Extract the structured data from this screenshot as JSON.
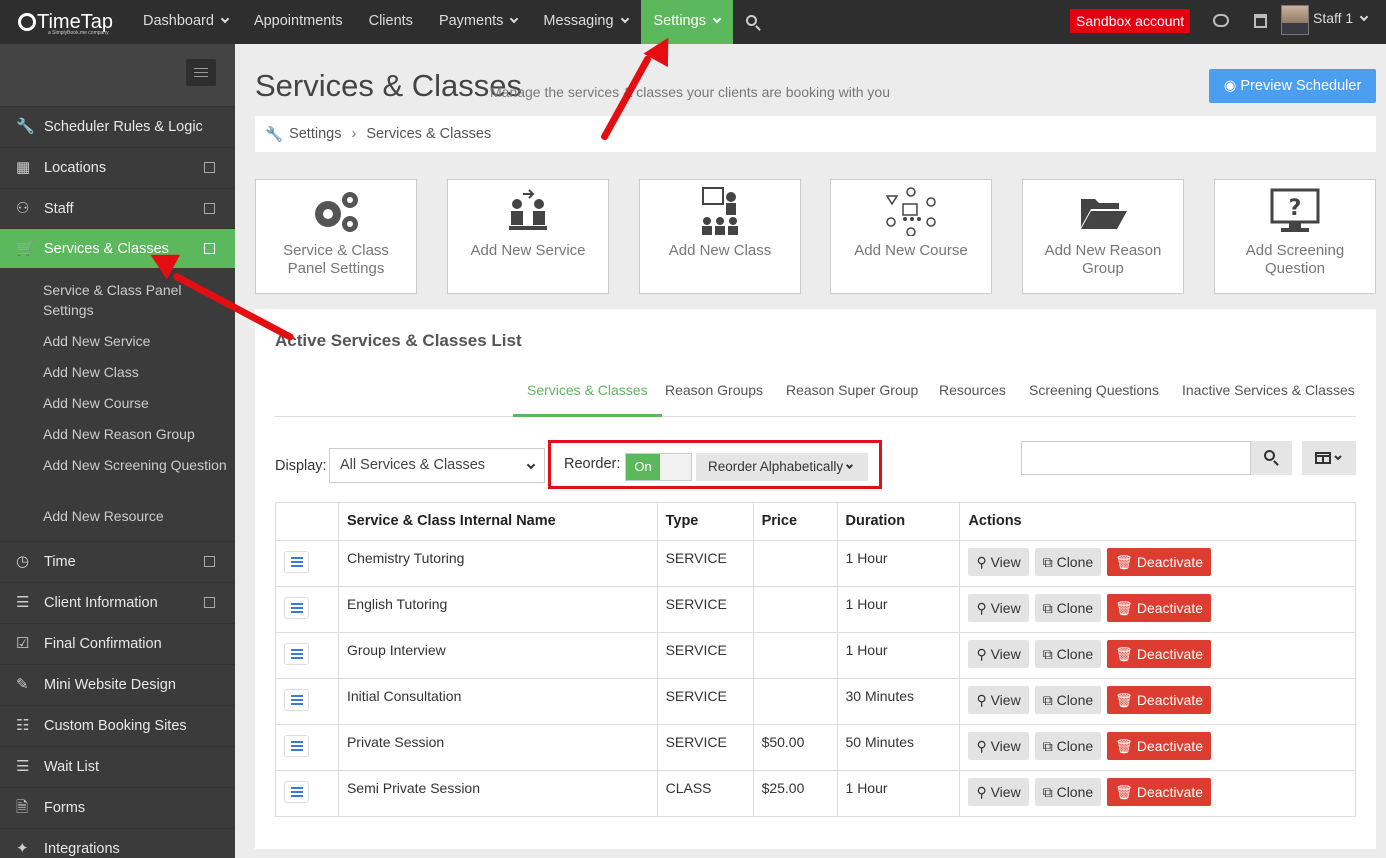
{
  "app": {
    "logo_text": "TimeTap",
    "logo_sub": "a SimplyBook.me company"
  },
  "topnav": {
    "items": [
      {
        "label": "Dashboard",
        "caret": true
      },
      {
        "label": "Appointments",
        "caret": false
      },
      {
        "label": "Clients",
        "caret": false
      },
      {
        "label": "Payments",
        "caret": true
      },
      {
        "label": "Messaging",
        "caret": true
      },
      {
        "label": "Settings",
        "caret": true,
        "active": true
      }
    ],
    "sandbox_label": "Sandbox account",
    "user_label": "Staff 1"
  },
  "sidebar": {
    "items": [
      {
        "label": "Scheduler Rules & Logic",
        "icon": "wrench-icon",
        "box": false
      },
      {
        "label": "Locations",
        "icon": "building-icon",
        "box": true
      },
      {
        "label": "Staff",
        "icon": "users-icon",
        "box": true
      },
      {
        "label": "Services & Classes",
        "icon": "cart-icon",
        "box": true,
        "active": true
      },
      {
        "label": "Time",
        "icon": "clock-icon",
        "box": true
      },
      {
        "label": "Client Information",
        "icon": "list-alt-icon",
        "box": true
      },
      {
        "label": "Final Confirmation",
        "icon": "check-square-icon",
        "box": false
      },
      {
        "label": "Mini Website Design",
        "icon": "edit-icon",
        "box": false
      },
      {
        "label": "Custom Booking Sites",
        "icon": "sitemap-icon",
        "box": false
      },
      {
        "label": "Wait List",
        "icon": "list-icon",
        "box": false
      },
      {
        "label": "Forms",
        "icon": "file-icon",
        "box": false
      },
      {
        "label": "Integrations",
        "icon": "puzzle-icon",
        "box": false
      }
    ],
    "subitems": [
      "Service & Class Panel Settings",
      "Add New Service",
      "Add New Class",
      "Add New Course",
      "Add New Reason Group",
      "Add New Screening Question",
      "Add New Resource"
    ]
  },
  "page": {
    "title": "Services & Classes",
    "subtitle": "Manage the services & classes your clients are booking with you",
    "preview_label": "Preview Scheduler",
    "breadcrumb": [
      "Settings",
      "Services & Classes"
    ]
  },
  "tiles": [
    {
      "label": "Service & Class Panel Settings",
      "icon": "cogs-icon"
    },
    {
      "label": "Add New Service",
      "icon": "service-icon"
    },
    {
      "label": "Add New Class",
      "icon": "class-icon"
    },
    {
      "label": "Add New Course",
      "icon": "course-icon"
    },
    {
      "label": "Add New Reason Group",
      "icon": "folder-open-icon"
    },
    {
      "label": "Add Screening Question",
      "icon": "screen-question-icon"
    }
  ],
  "list": {
    "title": "Active Services & Classes List",
    "tabs": [
      "Services & Classes",
      "Reason Groups",
      "Reason Super Group",
      "Resources",
      "Screening Questions",
      "Inactive Services & Classes"
    ],
    "active_tab": 0,
    "display_label": "Display:",
    "display_value": "All Services & Classes",
    "reorder_label": "Reorder:",
    "reorder_toggle": "On",
    "reorder_alpha": "Reorder Alphabetically",
    "columns": [
      "",
      "Service & Class Internal Name",
      "Type",
      "Price",
      "Duration",
      "Actions"
    ],
    "rows": [
      {
        "name": "Chemistry Tutoring",
        "type": "SERVICE",
        "price": "",
        "duration": "1 Hour"
      },
      {
        "name": "English Tutoring",
        "type": "SERVICE",
        "price": "",
        "duration": "1 Hour"
      },
      {
        "name": "Group Interview",
        "type": "SERVICE",
        "price": "",
        "duration": "1 Hour"
      },
      {
        "name": "Initial Consultation",
        "type": "SERVICE",
        "price": "",
        "duration": "30 Minutes"
      },
      {
        "name": "Private Session",
        "type": "SERVICE",
        "price": "$50.00",
        "duration": "50 Minutes"
      },
      {
        "name": "Semi Private Session",
        "type": "CLASS",
        "price": "$25.00",
        "duration": "1 Hour"
      }
    ],
    "actions": {
      "view": "View",
      "clone": "Clone",
      "deactivate": "Deactivate"
    }
  },
  "colors": {
    "accent": "#5cb85c",
    "primary": "#4a9ff0",
    "danger": "#dc3d30",
    "annotation": "#e40d12"
  }
}
